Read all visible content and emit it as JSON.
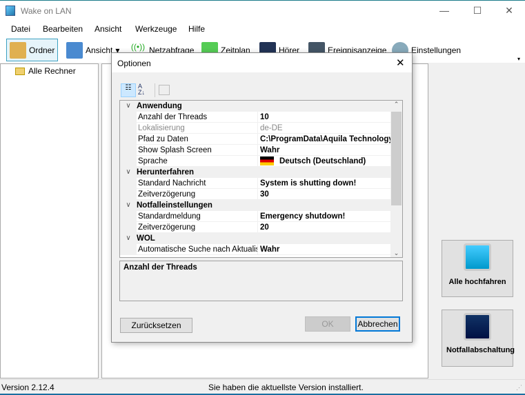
{
  "window": {
    "title": "Wake on LAN"
  },
  "menu": [
    "Datei",
    "Bearbeiten",
    "Ansicht",
    "Werkzeuge",
    "Hilfe"
  ],
  "toolbar": {
    "ordner": "Ordner",
    "ansicht": "Ansicht",
    "netzabfrage": "Netzabfrage",
    "zeitplan": "Zeitplan",
    "hoerer": "Hörer",
    "ereignis": "Ereignisanzeige",
    "einstellungen": "Einstellungen"
  },
  "tree": {
    "root": "Alle Rechner"
  },
  "actions": {
    "wake_all": "Alle hochfahren",
    "emergency": "Notfallabschaltung"
  },
  "status": {
    "version": "Version 2.12.4",
    "message": "Sie haben die aktuellste Version installiert."
  },
  "dialog": {
    "title": "Optionen",
    "categories": [
      {
        "name": "Anwendung",
        "props": [
          {
            "name": "Anzahl der Threads",
            "value": "10"
          },
          {
            "name": "Lokalisierung",
            "value": "de-DE",
            "disabled": true
          },
          {
            "name": "Pfad zu Daten",
            "value": "C:\\ProgramData\\Aquila Technology"
          },
          {
            "name": "Show Splash Screen",
            "value": "Wahr"
          },
          {
            "name": "Sprache",
            "value": "Deutsch (Deutschland)"
          }
        ]
      },
      {
        "name": "Herunterfahren",
        "props": [
          {
            "name": "Standard Nachricht",
            "value": "System is shutting down!"
          },
          {
            "name": "Zeitverzögerung",
            "value": "30"
          }
        ]
      },
      {
        "name": "Notfalleinstellungen",
        "props": [
          {
            "name": "Standardmeldung",
            "value": "Emergency shutdown!"
          },
          {
            "name": "Zeitverzögerung",
            "value": "20"
          }
        ]
      },
      {
        "name": "WOL",
        "props": [
          {
            "name": "Automatische Suche nach Aktualisierungen",
            "value": "Wahr"
          }
        ]
      }
    ],
    "description": "Anzahl der Threads",
    "reset": "Zurücksetzen",
    "ok": "OK",
    "cancel": "Abbrechen"
  }
}
